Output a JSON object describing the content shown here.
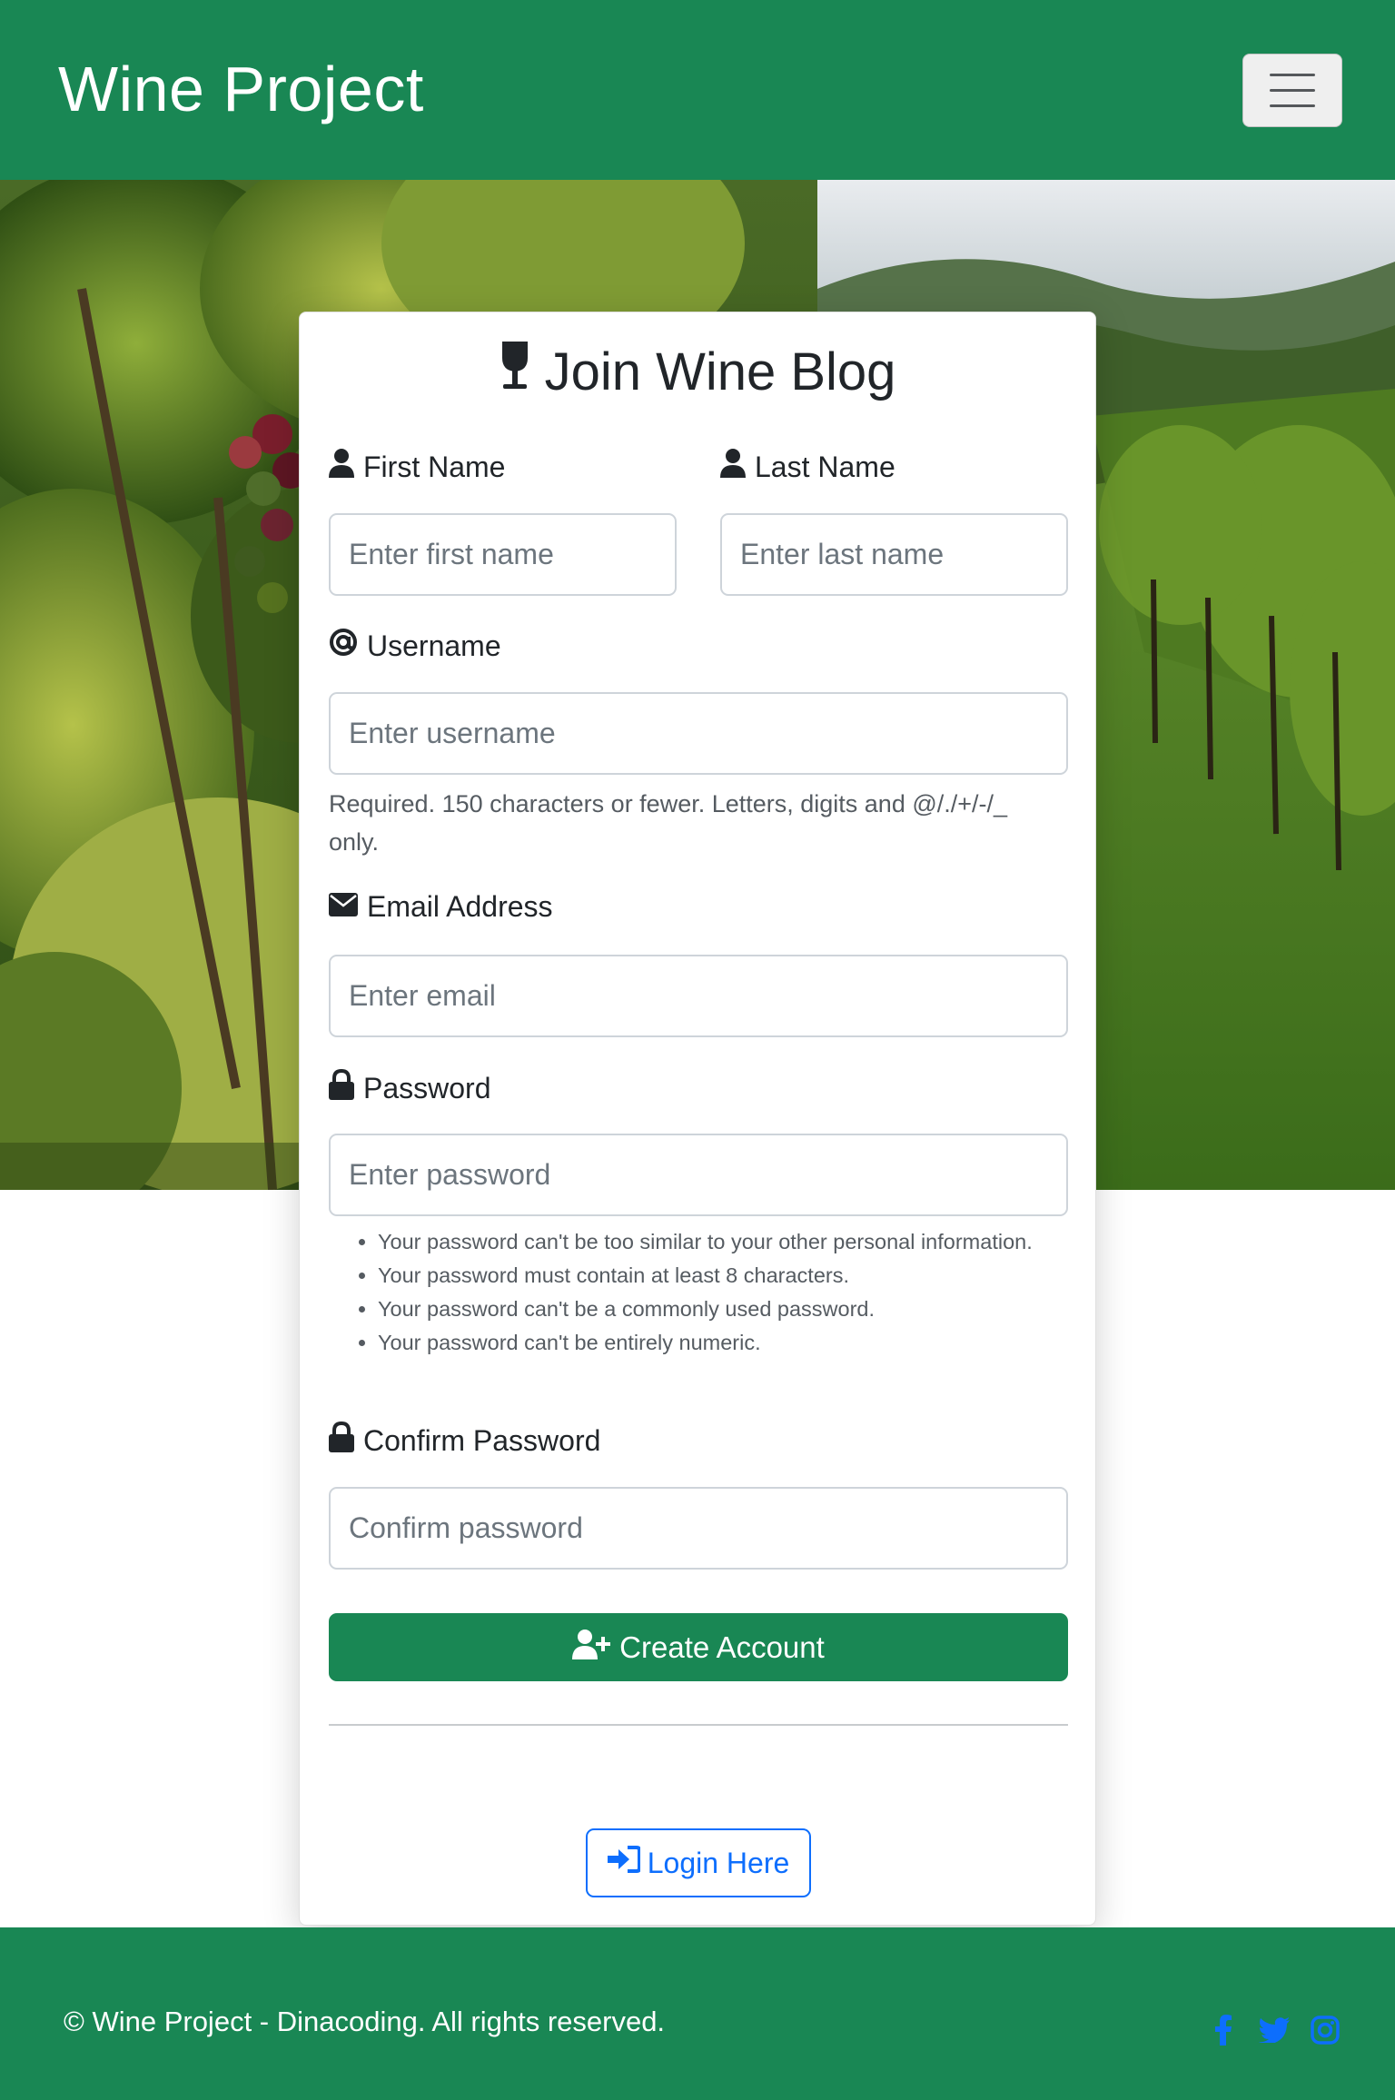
{
  "navbar": {
    "brand": "Wine Project",
    "toggler_icon": "hamburger-menu-icon"
  },
  "colors": {
    "primary_green": "#198754",
    "link_blue": "#0d6efd"
  },
  "card": {
    "title": "Join Wine Blog",
    "title_icon": "wine-glass-icon",
    "fields": {
      "first_name": {
        "label": "First Name",
        "placeholder": "Enter first name",
        "icon": "user-icon"
      },
      "last_name": {
        "label": "Last Name",
        "placeholder": "Enter last name",
        "icon": "user-icon"
      },
      "username": {
        "label": "Username",
        "placeholder": "Enter username",
        "icon": "at-sign-icon",
        "help_line1": "Required. 150 characters or fewer. Letters, digits and @/./+/-/_",
        "help_line2": "only."
      },
      "email": {
        "label": "Email Address",
        "placeholder": "Enter email",
        "icon": "envelope-icon"
      },
      "password": {
        "label": "Password",
        "placeholder": "Enter password",
        "icon": "lock-icon",
        "rules": [
          "Your password can't be too similar to your other personal information.",
          "Your password must contain at least 8 characters.",
          "Your password can't be a commonly used password.",
          "Your password can't be entirely numeric."
        ]
      },
      "confirm_password": {
        "label": "Confirm Password",
        "placeholder": "Confirm password",
        "icon": "lock-icon"
      }
    },
    "submit_label": "Create Account",
    "submit_icon": "user-plus-icon",
    "login_label": "Login Here",
    "login_icon": "sign-in-icon"
  },
  "footer": {
    "copyright": "© Wine Project - Dinacoding. All rights reserved.",
    "social_icons": [
      "facebook-icon",
      "twitter-icon",
      "instagram-icon"
    ]
  }
}
